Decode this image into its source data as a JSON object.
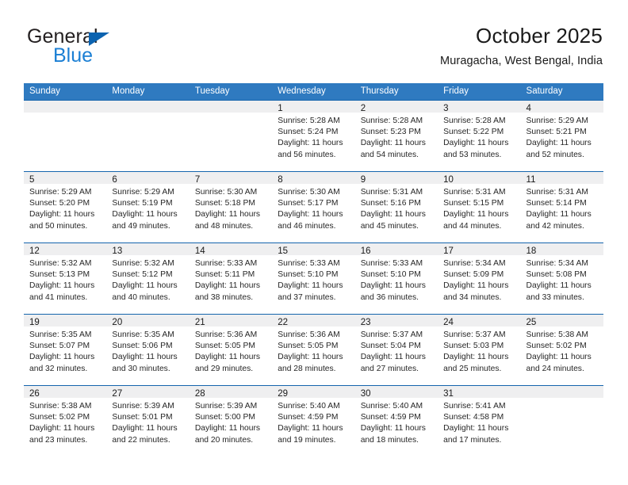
{
  "logo": {
    "word_one": "General",
    "word_two": "Blue",
    "triangle_color": "#0c63b0",
    "blue_color": "#1b7fd4"
  },
  "header": {
    "title": "October 2025",
    "subtitle": "Muragacha, West Bengal, India"
  },
  "theme": {
    "header_bar": "#2f7ac0",
    "row_divider": "#1565ad",
    "date_band": "#efeff0"
  },
  "calendar": {
    "weekdays": [
      "Sunday",
      "Monday",
      "Tuesday",
      "Wednesday",
      "Thursday",
      "Friday",
      "Saturday"
    ],
    "weeks": [
      [
        {
          "day": "",
          "lines": []
        },
        {
          "day": "",
          "lines": []
        },
        {
          "day": "",
          "lines": []
        },
        {
          "day": "1",
          "lines": [
            "Sunrise: 5:28 AM",
            "Sunset: 5:24 PM",
            "Daylight: 11 hours",
            "and 56 minutes."
          ]
        },
        {
          "day": "2",
          "lines": [
            "Sunrise: 5:28 AM",
            "Sunset: 5:23 PM",
            "Daylight: 11 hours",
            "and 54 minutes."
          ]
        },
        {
          "day": "3",
          "lines": [
            "Sunrise: 5:28 AM",
            "Sunset: 5:22 PM",
            "Daylight: 11 hours",
            "and 53 minutes."
          ]
        },
        {
          "day": "4",
          "lines": [
            "Sunrise: 5:29 AM",
            "Sunset: 5:21 PM",
            "Daylight: 11 hours",
            "and 52 minutes."
          ]
        }
      ],
      [
        {
          "day": "5",
          "lines": [
            "Sunrise: 5:29 AM",
            "Sunset: 5:20 PM",
            "Daylight: 11 hours",
            "and 50 minutes."
          ]
        },
        {
          "day": "6",
          "lines": [
            "Sunrise: 5:29 AM",
            "Sunset: 5:19 PM",
            "Daylight: 11 hours",
            "and 49 minutes."
          ]
        },
        {
          "day": "7",
          "lines": [
            "Sunrise: 5:30 AM",
            "Sunset: 5:18 PM",
            "Daylight: 11 hours",
            "and 48 minutes."
          ]
        },
        {
          "day": "8",
          "lines": [
            "Sunrise: 5:30 AM",
            "Sunset: 5:17 PM",
            "Daylight: 11 hours",
            "and 46 minutes."
          ]
        },
        {
          "day": "9",
          "lines": [
            "Sunrise: 5:31 AM",
            "Sunset: 5:16 PM",
            "Daylight: 11 hours",
            "and 45 minutes."
          ]
        },
        {
          "day": "10",
          "lines": [
            "Sunrise: 5:31 AM",
            "Sunset: 5:15 PM",
            "Daylight: 11 hours",
            "and 44 minutes."
          ]
        },
        {
          "day": "11",
          "lines": [
            "Sunrise: 5:31 AM",
            "Sunset: 5:14 PM",
            "Daylight: 11 hours",
            "and 42 minutes."
          ]
        }
      ],
      [
        {
          "day": "12",
          "lines": [
            "Sunrise: 5:32 AM",
            "Sunset: 5:13 PM",
            "Daylight: 11 hours",
            "and 41 minutes."
          ]
        },
        {
          "day": "13",
          "lines": [
            "Sunrise: 5:32 AM",
            "Sunset: 5:12 PM",
            "Daylight: 11 hours",
            "and 40 minutes."
          ]
        },
        {
          "day": "14",
          "lines": [
            "Sunrise: 5:33 AM",
            "Sunset: 5:11 PM",
            "Daylight: 11 hours",
            "and 38 minutes."
          ]
        },
        {
          "day": "15",
          "lines": [
            "Sunrise: 5:33 AM",
            "Sunset: 5:10 PM",
            "Daylight: 11 hours",
            "and 37 minutes."
          ]
        },
        {
          "day": "16",
          "lines": [
            "Sunrise: 5:33 AM",
            "Sunset: 5:10 PM",
            "Daylight: 11 hours",
            "and 36 minutes."
          ]
        },
        {
          "day": "17",
          "lines": [
            "Sunrise: 5:34 AM",
            "Sunset: 5:09 PM",
            "Daylight: 11 hours",
            "and 34 minutes."
          ]
        },
        {
          "day": "18",
          "lines": [
            "Sunrise: 5:34 AM",
            "Sunset: 5:08 PM",
            "Daylight: 11 hours",
            "and 33 minutes."
          ]
        }
      ],
      [
        {
          "day": "19",
          "lines": [
            "Sunrise: 5:35 AM",
            "Sunset: 5:07 PM",
            "Daylight: 11 hours",
            "and 32 minutes."
          ]
        },
        {
          "day": "20",
          "lines": [
            "Sunrise: 5:35 AM",
            "Sunset: 5:06 PM",
            "Daylight: 11 hours",
            "and 30 minutes."
          ]
        },
        {
          "day": "21",
          "lines": [
            "Sunrise: 5:36 AM",
            "Sunset: 5:05 PM",
            "Daylight: 11 hours",
            "and 29 minutes."
          ]
        },
        {
          "day": "22",
          "lines": [
            "Sunrise: 5:36 AM",
            "Sunset: 5:05 PM",
            "Daylight: 11 hours",
            "and 28 minutes."
          ]
        },
        {
          "day": "23",
          "lines": [
            "Sunrise: 5:37 AM",
            "Sunset: 5:04 PM",
            "Daylight: 11 hours",
            "and 27 minutes."
          ]
        },
        {
          "day": "24",
          "lines": [
            "Sunrise: 5:37 AM",
            "Sunset: 5:03 PM",
            "Daylight: 11 hours",
            "and 25 minutes."
          ]
        },
        {
          "day": "25",
          "lines": [
            "Sunrise: 5:38 AM",
            "Sunset: 5:02 PM",
            "Daylight: 11 hours",
            "and 24 minutes."
          ]
        }
      ],
      [
        {
          "day": "26",
          "lines": [
            "Sunrise: 5:38 AM",
            "Sunset: 5:02 PM",
            "Daylight: 11 hours",
            "and 23 minutes."
          ]
        },
        {
          "day": "27",
          "lines": [
            "Sunrise: 5:39 AM",
            "Sunset: 5:01 PM",
            "Daylight: 11 hours",
            "and 22 minutes."
          ]
        },
        {
          "day": "28",
          "lines": [
            "Sunrise: 5:39 AM",
            "Sunset: 5:00 PM",
            "Daylight: 11 hours",
            "and 20 minutes."
          ]
        },
        {
          "day": "29",
          "lines": [
            "Sunrise: 5:40 AM",
            "Sunset: 4:59 PM",
            "Daylight: 11 hours",
            "and 19 minutes."
          ]
        },
        {
          "day": "30",
          "lines": [
            "Sunrise: 5:40 AM",
            "Sunset: 4:59 PM",
            "Daylight: 11 hours",
            "and 18 minutes."
          ]
        },
        {
          "day": "31",
          "lines": [
            "Sunrise: 5:41 AM",
            "Sunset: 4:58 PM",
            "Daylight: 11 hours",
            "and 17 minutes."
          ]
        },
        {
          "day": "",
          "lines": []
        }
      ]
    ]
  }
}
